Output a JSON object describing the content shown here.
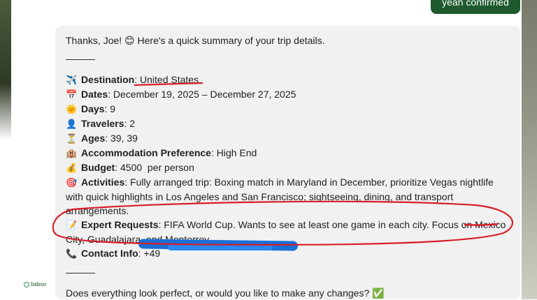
{
  "user_message": "yeah confirmed",
  "bot": {
    "avatar_label": "baboo",
    "intro": "Thanks, Joe! 😊 Here's a quick summary of your trip details.",
    "items": [
      {
        "icon": "airplane-icon",
        "emoji": "✈️",
        "label": "Destination",
        "value": "United States"
      },
      {
        "icon": "calendar-icon",
        "emoji": "📅",
        "label": "Dates",
        "value": "December 19, 2025 – December 27, 2025"
      },
      {
        "icon": "sun-icon",
        "emoji": "🌞",
        "label": "Days",
        "value": "9"
      },
      {
        "icon": "person-icon",
        "emoji": "👤",
        "label": "Travelers",
        "value": "2"
      },
      {
        "icon": "hourglass-icon",
        "emoji": "⏳",
        "label": "Ages",
        "value": "39, 39"
      },
      {
        "icon": "hotel-icon",
        "emoji": "🏨",
        "label": "Accommodation Preference",
        "value": "High End"
      },
      {
        "icon": "money-bag-icon",
        "emoji": "💰",
        "label": "Budget",
        "value": "4500  per person"
      },
      {
        "icon": "target-icon",
        "emoji": "🎯",
        "label": "Activities",
        "value": "Fully arranged trip: Boxing match in Maryland in December, prioritize Vegas nightlife with quick highlights in Los Angeles and San Francisco; sightseeing, dining, and transport arrangements."
      },
      {
        "icon": "memo-icon",
        "emoji": "📝",
        "label": "Expert Requests",
        "value": "FIFA World Cup. Wants to see at least one game in each city. Focus on Mexico City, Guadalajara, and Monterrey."
      },
      {
        "icon": "phone-icon",
        "emoji": "📞",
        "label": "Contact Info",
        "value": "+49"
      }
    ],
    "closing": "Does everything look perfect, or would you like to make any changes? ✅"
  },
  "annotation_color": "#d81e2a",
  "redaction_color": "#1a6fd6"
}
